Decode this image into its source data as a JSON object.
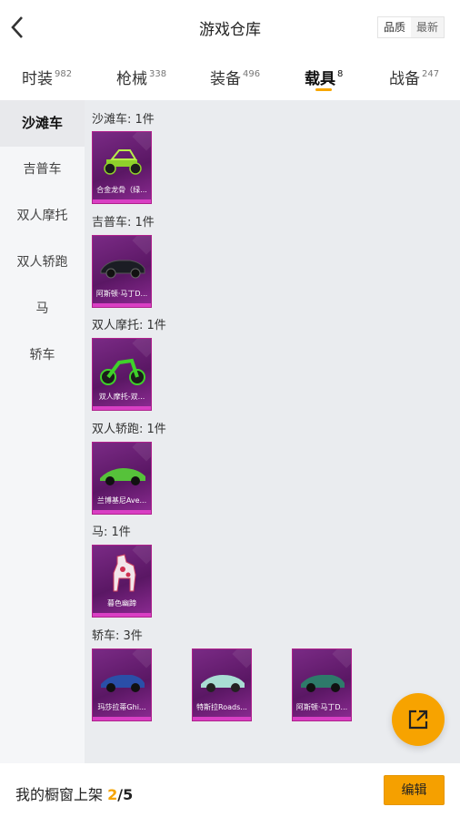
{
  "header": {
    "title": "游戏仓库",
    "sort_options": [
      "品质",
      "最新"
    ]
  },
  "tabs": [
    {
      "label": "时装",
      "count": "982"
    },
    {
      "label": "枪械",
      "count": "338"
    },
    {
      "label": "装备",
      "count": "496"
    },
    {
      "label": "载具",
      "count": "8"
    },
    {
      "label": "战备",
      "count": "247"
    }
  ],
  "active_tab": "载具",
  "sidebar": {
    "items": [
      "沙滩车",
      "吉普车",
      "双人摩托",
      "双人轿跑",
      "马",
      "轿车"
    ],
    "active": "沙滩车"
  },
  "groups": [
    {
      "title": "沙滩车: 1件",
      "items": [
        {
          "name": "合金龙骨（绿...",
          "icon": "buggy-icon",
          "color": "#8fd12b"
        }
      ]
    },
    {
      "title": "吉普车: 1件",
      "items": [
        {
          "name": "阿斯顿·马丁D...",
          "icon": "sports-car-icon",
          "color": "#1b1d24"
        }
      ]
    },
    {
      "title": "双人摩托: 1件",
      "items": [
        {
          "name": "双人摩托-双...",
          "icon": "motorcycle-icon",
          "color": "#3fd12a"
        }
      ]
    },
    {
      "title": "双人轿跑: 1件",
      "items": [
        {
          "name": "兰博基尼Ave...",
          "icon": "supercar-icon",
          "color": "#56c23a"
        }
      ]
    },
    {
      "title": "马: 1件",
      "items": [
        {
          "name": "暮色幽蹄",
          "icon": "horse-icon",
          "color": "#f2e6ea"
        }
      ]
    },
    {
      "title": "轿车: 3件",
      "items": [
        {
          "name": "玛莎拉蒂Ghi...",
          "icon": "sedan-icon",
          "color": "#2a4fa8"
        },
        {
          "name": "特斯拉Roads...",
          "icon": "roadster-icon",
          "color": "#a9ddd4"
        },
        {
          "name": "阿斯顿·马丁D...",
          "icon": "coupe-icon",
          "color": "#2e7a6a"
        }
      ]
    }
  ],
  "bottom": {
    "shelf_label": "我的橱窗上架 ",
    "shelf_count": "2",
    "shelf_total": "/5",
    "edit_label": "编辑"
  },
  "fab_icon": "share-icon",
  "colors": {
    "accent": "#f7a300",
    "card_border": "#b0208c",
    "card_stripe": "#d93fc4"
  }
}
